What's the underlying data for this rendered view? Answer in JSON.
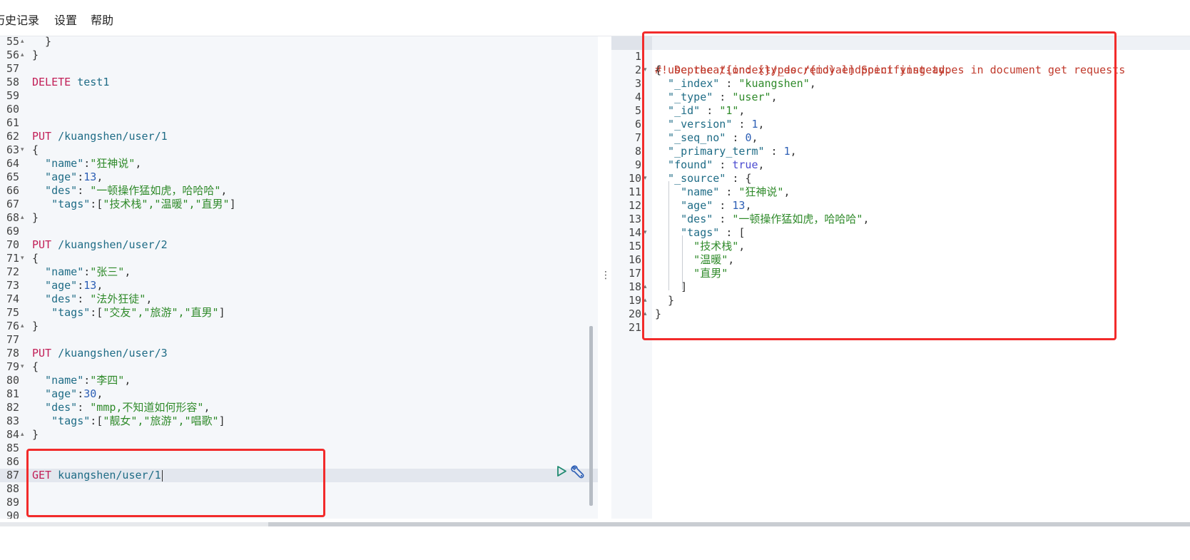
{
  "menu": {
    "history": "历史记录",
    "settings": "设置",
    "help": "帮助"
  },
  "left_editor": {
    "lines": [
      {
        "n": "55",
        "fold": "▴",
        "code": "  }"
      },
      {
        "n": "56",
        "fold": "▴",
        "code": "}"
      },
      {
        "n": "57",
        "fold": "",
        "code": ""
      },
      {
        "n": "58",
        "fold": "",
        "method": "DELETE",
        "path": " test1"
      },
      {
        "n": "59",
        "fold": "",
        "code": ""
      },
      {
        "n": "60",
        "fold": "",
        "code": ""
      },
      {
        "n": "61",
        "fold": "",
        "code": ""
      },
      {
        "n": "62",
        "fold": "",
        "method": "PUT",
        "path": " /kuangshen/user/1"
      },
      {
        "n": "63",
        "fold": "▾",
        "code": "{"
      },
      {
        "n": "64",
        "fold": "",
        "k": "  \"name\"",
        "sep": ":",
        "v": "\"狂神说\"",
        "end": ","
      },
      {
        "n": "65",
        "fold": "",
        "k": "  \"age\"",
        "sep": ":",
        "num": "13",
        "end": ","
      },
      {
        "n": "66",
        "fold": "",
        "k": "  \"des\"",
        "sep": ": ",
        "v": "\"一顿操作猛如虎，哈哈哈\"",
        "end": ","
      },
      {
        "n": "67",
        "fold": "",
        "k": "   \"tags\"",
        "sep": ":[",
        "v": "\"技术栈\",\"温暖\",\"直男\"",
        "end": "]"
      },
      {
        "n": "68",
        "fold": "▴",
        "code": "}"
      },
      {
        "n": "69",
        "fold": "",
        "code": ""
      },
      {
        "n": "70",
        "fold": "",
        "method": "PUT",
        "path": " /kuangshen/user/2"
      },
      {
        "n": "71",
        "fold": "▾",
        "code": "{"
      },
      {
        "n": "72",
        "fold": "",
        "k": "  \"name\"",
        "sep": ":",
        "v": "\"张三\"",
        "end": ","
      },
      {
        "n": "73",
        "fold": "",
        "k": "  \"age\"",
        "sep": ":",
        "num": "13",
        "end": ","
      },
      {
        "n": "74",
        "fold": "",
        "k": "  \"des\"",
        "sep": ": ",
        "v": "\"法外狂徒\"",
        "end": ","
      },
      {
        "n": "75",
        "fold": "",
        "k": "   \"tags\"",
        "sep": ":[",
        "v": "\"交友\",\"旅游\",\"直男\"",
        "end": "]"
      },
      {
        "n": "76",
        "fold": "▴",
        "code": "}"
      },
      {
        "n": "77",
        "fold": "",
        "code": ""
      },
      {
        "n": "78",
        "fold": "",
        "method": "PUT",
        "path": " /kuangshen/user/3"
      },
      {
        "n": "79",
        "fold": "▾",
        "code": "{"
      },
      {
        "n": "80",
        "fold": "",
        "k": "  \"name\"",
        "sep": ":",
        "v": "\"李四\"",
        "end": ","
      },
      {
        "n": "81",
        "fold": "",
        "k": "  \"age\"",
        "sep": ":",
        "num": "30",
        "end": ","
      },
      {
        "n": "82",
        "fold": "",
        "k": "  \"des\"",
        "sep": ": ",
        "v": "\"mmp,不知道如何形容\"",
        "end": ","
      },
      {
        "n": "83",
        "fold": "",
        "k": "   \"tags\"",
        "sep": ":[",
        "v": "\"靓女\",\"旅游\",\"唱歌\"",
        "end": "]"
      },
      {
        "n": "84",
        "fold": "▴",
        "code": "}"
      },
      {
        "n": "85",
        "fold": "",
        "code": ""
      },
      {
        "n": "86",
        "fold": "",
        "code": ""
      },
      {
        "n": "87",
        "fold": "",
        "method": "GET",
        "path": " kuangshen/user/1",
        "active": true
      },
      {
        "n": "88",
        "fold": "",
        "code": ""
      },
      {
        "n": "89",
        "fold": "",
        "code": ""
      },
      {
        "n": "90",
        "fold": "",
        "code": ""
      }
    ]
  },
  "right_editor": {
    "warning_line1": "#! Deprecation: [types removal] Specifying types in document get requests",
    "warning_line2": "  use the /{index}/_doc/{id} endpoint instead.",
    "lines": [
      {
        "n": "2",
        "fold": "▾",
        "code": "{"
      },
      {
        "n": "3",
        "fold": "",
        "k": "  \"_index\"",
        "sep": " : ",
        "v": "\"kuangshen\"",
        "end": ","
      },
      {
        "n": "4",
        "fold": "",
        "k": "  \"_type\"",
        "sep": " : ",
        "v": "\"user\"",
        "end": ","
      },
      {
        "n": "5",
        "fold": "",
        "k": "  \"_id\"",
        "sep": " : ",
        "v": "\"1\"",
        "end": ","
      },
      {
        "n": "6",
        "fold": "",
        "k": "  \"_version\"",
        "sep": " : ",
        "num": "1",
        "end": ","
      },
      {
        "n": "7",
        "fold": "",
        "k": "  \"_seq_no\"",
        "sep": " : ",
        "num": "0",
        "end": ","
      },
      {
        "n": "8",
        "fold": "",
        "k": "  \"_primary_term\"",
        "sep": " : ",
        "num": "1",
        "end": ","
      },
      {
        "n": "9",
        "fold": "",
        "k": "  \"found\"",
        "sep": " : ",
        "bool": "true",
        "end": ","
      },
      {
        "n": "10",
        "fold": "▾",
        "k": "  \"_source\"",
        "sep": " : ",
        "end": "{"
      },
      {
        "n": "11",
        "fold": "",
        "k": "    \"name\"",
        "sep": " : ",
        "v": "\"狂神说\"",
        "end": ","
      },
      {
        "n": "12",
        "fold": "",
        "k": "    \"age\"",
        "sep": " : ",
        "num": "13",
        "end": ","
      },
      {
        "n": "13",
        "fold": "",
        "k": "    \"des\"",
        "sep": " : ",
        "v": "\"一顿操作猛如虎，哈哈哈\"",
        "end": ","
      },
      {
        "n": "14",
        "fold": "▾",
        "k": "    \"tags\"",
        "sep": " : ",
        "end": "["
      },
      {
        "n": "15",
        "fold": "",
        "v": "      \"技术栈\"",
        "end": ","
      },
      {
        "n": "16",
        "fold": "",
        "v": "      \"温暖\"",
        "end": ","
      },
      {
        "n": "17",
        "fold": "",
        "v": "      \"直男\"",
        "end": ""
      },
      {
        "n": "18",
        "fold": "▴",
        "code": "    ]"
      },
      {
        "n": "19",
        "fold": "▴",
        "code": "  }"
      },
      {
        "n": "20",
        "fold": "▴",
        "code": "}"
      },
      {
        "n": "21",
        "fold": "",
        "code": ""
      }
    ],
    "first_line_number": "1"
  },
  "colors": {
    "keyword": "#c21f57",
    "string": "#2f8a2a",
    "key": "#1f6c86",
    "number": "#2d5fb5",
    "warning": "#c0392b",
    "highlight_box": "#f22b2b",
    "run_button": "#1f8a70",
    "wrench_button": "#2d5fb5"
  },
  "icons": {
    "run": "play-triangle-icon",
    "wrench": "wrench-icon",
    "splitter": "vertical-dots-icon"
  }
}
